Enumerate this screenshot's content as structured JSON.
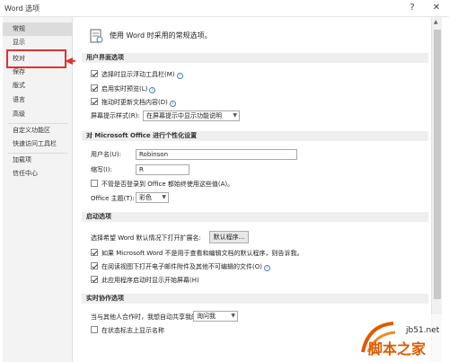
{
  "window": {
    "title": "Word 选项",
    "help": "?",
    "close": "✕"
  },
  "sidebar": {
    "items": [
      {
        "label": "常规"
      },
      {
        "label": "显示"
      },
      {
        "label": "校对"
      },
      {
        "label": "保存"
      },
      {
        "label": "版式"
      },
      {
        "label": "语言"
      },
      {
        "label": "高级"
      },
      {
        "label": "自定义功能区"
      },
      {
        "label": "快速访问工具栏"
      },
      {
        "label": "加载项"
      },
      {
        "label": "信任中心"
      }
    ],
    "selected": "常规"
  },
  "intro": {
    "text": "使用 Word 时采用的常规选项。"
  },
  "ui_options": {
    "header": "用户界面选项",
    "checkboxes": [
      {
        "label": "选择时显示浮动工具栏(M)",
        "checked": true,
        "info": true
      },
      {
        "label": "启用实时预览(L)",
        "checked": true,
        "info": true
      },
      {
        "label": "拖动时更新文档内容(D)",
        "checked": true,
        "info": true
      }
    ],
    "screen_tip_label": "屏幕提示样式(R):",
    "screen_tip_value": "在屏幕提示中显示功能说明"
  },
  "personalize": {
    "header": "对 Microsoft Office 进行个性化设置",
    "username_label": "用户名(U):",
    "username_value": "Robinson",
    "initials_label": "缩写(I):",
    "initials_value": "R",
    "always_use_label": "不管是否登录到 Office 都始终使用这些值(A)。",
    "always_use_checked": false,
    "theme_label": "Office 主题(T):",
    "theme_value": "彩色"
  },
  "startup": {
    "header": "启动选项",
    "default_program_label": "选择希望 Word 默认情况下打开扩展名:",
    "default_program_button": "默认程序...",
    "checkboxes": [
      {
        "label": "如果 Microsoft Word 不是用于查看和编辑文档的默认程序，则告诉我。",
        "checked": true
      },
      {
        "label": "在阅读视图下打开电子邮件附件及其他不可编辑的文件(O)",
        "checked": true,
        "info": true
      },
      {
        "label": "此应用程序启动时显示开始屏幕(H)",
        "checked": true
      }
    ]
  },
  "collab": {
    "header": "实时协作选项",
    "share_label": "当与其他人合作时，我想自动共享我的更改:",
    "share_value": "询问我",
    "show_names_label": "在状态标志上显示名称",
    "show_names_checked": false
  },
  "watermark": {
    "site": "jb51.net",
    "brand": "脚本之家"
  },
  "colors": {
    "callout": "#e03131",
    "selected_bg": "#dcdcdc",
    "section_bg": "#efefef",
    "brand_orange": "#e05a00"
  }
}
